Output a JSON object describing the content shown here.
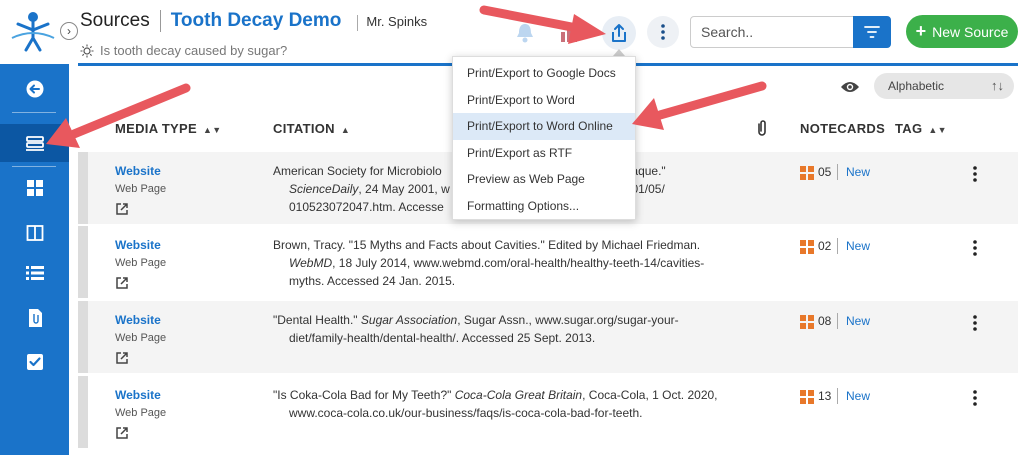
{
  "header": {
    "section_title": "Sources",
    "project_title": "Tooth Decay Demo",
    "owner": "Mr. Spinks",
    "question": "Is tooth decay caused by sugar?"
  },
  "search": {
    "placeholder": "Search.."
  },
  "new_source_label": "New Source",
  "sort": {
    "selected": "Alphabetic"
  },
  "table": {
    "headers": {
      "media_type": "MEDIA TYPE",
      "citation": "CITATION",
      "notecards": "NOTECARDS",
      "tag": "TAG"
    },
    "rows": [
      {
        "media_type": "Website",
        "media_sub": "Web Page",
        "citation_pre": "American Society for Microbiolo",
        "citation_tail": "Plaque.\"",
        "citation_italic": "ScienceDaily",
        "citation_post": ", 24 May 2001, w",
        "citation_post2": "001/05/",
        "citation_line3": "010523072047.htm. Accesse",
        "notecards": "05",
        "new_label": "New"
      },
      {
        "media_type": "Website",
        "media_sub": "Web Page",
        "citation_pre": "Brown, Tracy. \"15 Myths and Facts about Cavities.\" Edited by Michael Friedman. ",
        "citation_italic": "WebMD",
        "citation_post": ", 18 July 2014, www.webmd.com/oral-health/healthy-teeth-14/cavities-myths. Accessed 24 Jan. 2015.",
        "notecards": "02",
        "new_label": "New"
      },
      {
        "media_type": "Website",
        "media_sub": "Web Page",
        "citation_pre": "\"Dental Health.\" ",
        "citation_italic": "Sugar Association",
        "citation_post": ", Sugar Assn., www.sugar.org/sugar-your-diet/family-health/dental-health/. Accessed 25 Sept. 2013.",
        "notecards": "08",
        "new_label": "New"
      },
      {
        "media_type": "Website",
        "media_sub": "Web Page",
        "citation_pre": "\"Is Coka-Cola Bad for My Teeth?\" ",
        "citation_italic": "Coca-Cola Great Britain",
        "citation_post": ", Coca-Cola, 1 Oct. 2020, www.coca-cola.co.uk/our-business/faqs/is-coca-cola-bad-for-teeth.",
        "notecards": "13",
        "new_label": "New"
      }
    ]
  },
  "export_menu": {
    "items": [
      "Print/Export to Google Docs",
      "Print/Export to Word",
      "Print/Export to Word Online",
      "Print/Export as RTF",
      "Preview as Web Page",
      "Formatting Options..."
    ],
    "highlighted_index": 2
  },
  "colors": {
    "primary": "#1a73c9",
    "sidebar_active": "#0c57a3",
    "new_source": "#3cb04a",
    "notecard": "#e8782a",
    "annotation_arrow": "#e8585e"
  }
}
